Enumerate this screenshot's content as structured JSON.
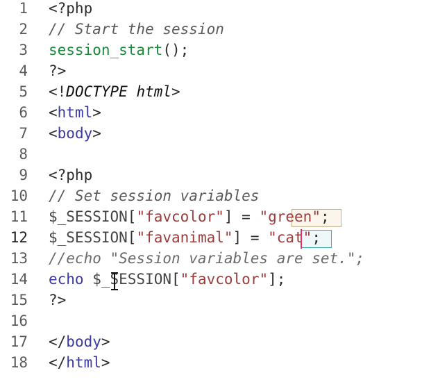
{
  "editor": {
    "lines": [
      {
        "num": "1",
        "tokens": [
          {
            "t": "<?php",
            "c": "c-tag"
          }
        ]
      },
      {
        "num": "2",
        "tokens": [
          {
            "t": "// Start the session",
            "c": "c-cmt"
          }
        ]
      },
      {
        "num": "3",
        "tokens": [
          {
            "t": "session_start",
            "c": "c-fn"
          },
          {
            "t": "();",
            "c": "c-pun"
          }
        ]
      },
      {
        "num": "4",
        "tokens": [
          {
            "t": "?>",
            "c": "c-tag"
          }
        ]
      },
      {
        "num": "5",
        "tokens": [
          {
            "t": "<!",
            "c": "c-pun"
          },
          {
            "t": "DOCTYPE html",
            "c": "c-doc"
          },
          {
            "t": ">",
            "c": "c-pun"
          }
        ]
      },
      {
        "num": "6",
        "tokens": [
          {
            "t": "<",
            "c": "c-pun"
          },
          {
            "t": "html",
            "c": "c-el"
          },
          {
            "t": ">",
            "c": "c-pun"
          }
        ]
      },
      {
        "num": "7",
        "tokens": [
          {
            "t": "<",
            "c": "c-pun"
          },
          {
            "t": "body",
            "c": "c-el"
          },
          {
            "t": ">",
            "c": "c-pun"
          }
        ]
      },
      {
        "num": "8",
        "tokens": []
      },
      {
        "num": "9",
        "tokens": [
          {
            "t": "<?php",
            "c": "c-tag"
          }
        ]
      },
      {
        "num": "10",
        "tokens": [
          {
            "t": "// Set session variables",
            "c": "c-cmt"
          }
        ]
      },
      {
        "num": "11",
        "tokens": [
          {
            "t": "$_SESSION",
            "c": "c-var"
          },
          {
            "t": "[",
            "c": "c-pun"
          },
          {
            "t": "\"favcolor\"",
            "c": "c-str"
          },
          {
            "t": "] = ",
            "c": "c-pun"
          },
          {
            "t": "\"green\"",
            "c": "c-str"
          },
          {
            "t": ";",
            "c": "c-pun"
          }
        ]
      },
      {
        "num": "12",
        "tokens": [
          {
            "t": "$_SESSION",
            "c": "c-var"
          },
          {
            "t": "[",
            "c": "c-pun"
          },
          {
            "t": "\"favanimal\"",
            "c": "c-str"
          },
          {
            "t": "] = ",
            "c": "c-pun"
          },
          {
            "t": "\"cat\"",
            "c": "c-str"
          },
          {
            "t": ";",
            "c": "c-pun"
          }
        ]
      },
      {
        "num": "13",
        "tokens": [
          {
            "t": "//echo \"Session variables are set.\";",
            "c": "c-cmt2"
          }
        ]
      },
      {
        "num": "14",
        "tokens": [
          {
            "t": "echo ",
            "c": "c-kw"
          },
          {
            "t": "$_SESSION",
            "c": "c-var"
          },
          {
            "t": "[",
            "c": "c-pun"
          },
          {
            "t": "\"favcolor\"",
            "c": "c-str"
          },
          {
            "t": "];",
            "c": "c-pun"
          }
        ]
      },
      {
        "num": "15",
        "tokens": [
          {
            "t": "?>",
            "c": "c-tag"
          }
        ]
      },
      {
        "num": "16",
        "tokens": []
      },
      {
        "num": "17",
        "tokens": [
          {
            "t": "</",
            "c": "c-pun"
          },
          {
            "t": "body",
            "c": "c-el"
          },
          {
            "t": ">",
            "c": "c-pun"
          }
        ]
      },
      {
        "num": "18",
        "tokens": [
          {
            "t": "</",
            "c": "c-pun"
          },
          {
            "t": "html",
            "c": "c-el"
          },
          {
            "t": ">",
            "c": "c-pun"
          }
        ]
      }
    ],
    "active_line": "12",
    "colors": {
      "background": "#ffffff",
      "comment": "#5a5a5a",
      "function": "#1a8a3a",
      "element": "#3a3aa0",
      "string": "#9a3c3c",
      "caret": "#e0306a",
      "match_highlight": "#38b0b0"
    },
    "cursor_icon": "text-cursor-ibeam-icon"
  }
}
